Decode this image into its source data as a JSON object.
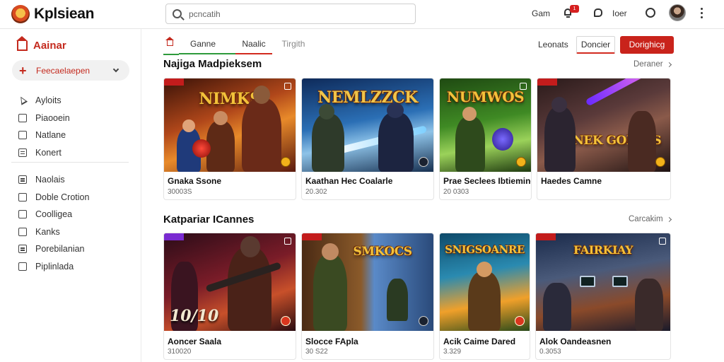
{
  "app": {
    "title": "Kplsiean"
  },
  "search": {
    "placeholder": "pcncatih"
  },
  "topbar": {
    "link_1": "Gam",
    "badge": "1",
    "link_2": "Ioer",
    "icons": [
      "bell-icon",
      "chat-icon",
      "circle-icon",
      "avatar",
      "kebab-icon"
    ]
  },
  "sidebar": {
    "header": "Aainar",
    "pill": "Feecaelaepen",
    "group_1": [
      {
        "label": "Ayloits",
        "icon": "cursor-icon"
      },
      {
        "label": "Piaooein",
        "icon": "square-icon"
      },
      {
        "label": "Natlane",
        "icon": "square-icon"
      },
      {
        "label": "Konert",
        "icon": "lines-icon"
      }
    ],
    "group_2": [
      {
        "label": "Naolais",
        "icon": "calendar-icon"
      },
      {
        "label": "Doble Crotion",
        "icon": "square-icon"
      },
      {
        "label": "Coolligea",
        "icon": "square-icon"
      },
      {
        "label": "Kanks",
        "icon": "square-icon"
      },
      {
        "label": "Porebilanian",
        "icon": "lines-icon"
      },
      {
        "label": "Piplinlada",
        "icon": "square-icon"
      }
    ]
  },
  "tabs": [
    {
      "label": ""
    },
    {
      "label": "Ganne"
    },
    {
      "label": "Naalic"
    },
    {
      "label": "Tirgith"
    }
  ],
  "toolbar": {
    "link": "Leonats",
    "outline_button": "Doncier",
    "primary_button": "Dorighicg"
  },
  "sections": [
    {
      "title": "Najiga Madpieksem",
      "see_all": "Deraner",
      "cards": [
        {
          "title": "Gnaka Ssone",
          "sub": "30003S",
          "art_text": "NIMKS"
        },
        {
          "title": "Kaathan Hec Coalarle",
          "sub": "20.302",
          "art_text": "NEMLZZCK"
        },
        {
          "title": "Prae Seclees Ibtiemine",
          "sub": "20 0303",
          "art_text": "NUMWOS"
        },
        {
          "title": "Haedes Camne",
          "sub": "",
          "art_text": "YAKNEK GONNIS"
        }
      ]
    },
    {
      "title": "Katpariar ICannes",
      "see_all": "Carcakim",
      "cards": [
        {
          "title": "Aoncer Saala",
          "sub": "310020",
          "art_text": "10/10"
        },
        {
          "title": "Slocce FApla",
          "sub": "30 S22",
          "art_text": "SMKOCS"
        },
        {
          "title": "Acik Caime Dared",
          "sub": "3.329",
          "art_text": "SNIGSOANRE"
        },
        {
          "title": "Alok Oandeasnen",
          "sub": "0.3053",
          "art_text": "FAIRKIAY"
        }
      ]
    }
  ],
  "colors": {
    "accent_red": "#c9231b",
    "accent_green": "#2e9a3c",
    "text": "#222222"
  }
}
